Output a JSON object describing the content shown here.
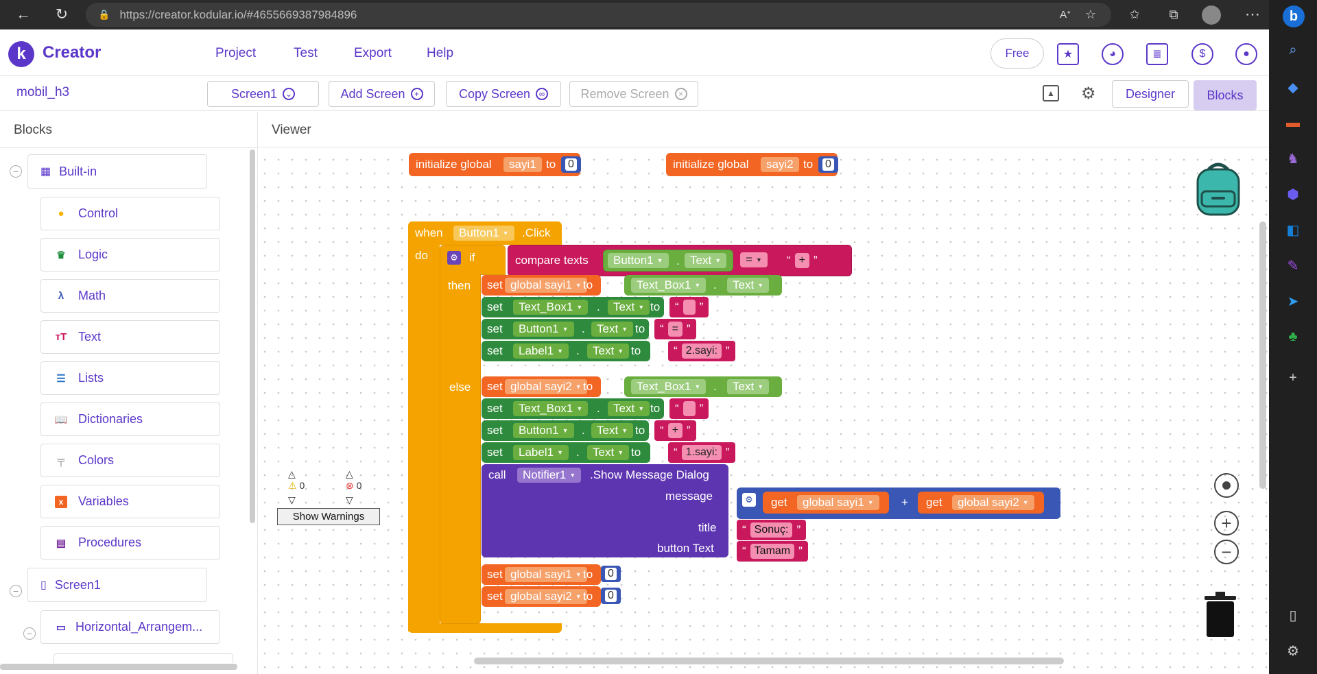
{
  "browser": {
    "url": "https://creator.kodular.io/#4655669387984896"
  },
  "header": {
    "brand": "Creator",
    "logo_letter": "k",
    "menu": [
      "Project",
      "Test",
      "Export",
      "Help"
    ],
    "plan": "Free"
  },
  "toolbar": {
    "project_name": "mobil_h3",
    "screen": "Screen1",
    "add_screen": "Add Screen",
    "copy_screen": "Copy Screen",
    "remove_screen": "Remove Screen",
    "designer": "Designer",
    "blocks": "Blocks"
  },
  "blocks_panel": {
    "title": "Blocks",
    "builtin": "Built-in",
    "categories": [
      {
        "label": "Control",
        "color": "#f4b400"
      },
      {
        "label": "Logic",
        "color": "#1e8e3e"
      },
      {
        "label": "Math",
        "color": "#3a57b5"
      },
      {
        "label": "Text",
        "color": "#c9185b"
      },
      {
        "label": "Lists",
        "color": "#2574c9"
      },
      {
        "label": "Dictionaries",
        "color": "#3a3aa3"
      },
      {
        "label": "Colors",
        "color": "#888888"
      },
      {
        "label": "Variables",
        "color": "#f26522"
      },
      {
        "label": "Procedures",
        "color": "#7b2fa0"
      }
    ],
    "screen": "Screen1",
    "horizontal": "Horizontal_Arrangem..."
  },
  "viewer": {
    "title": "Viewer",
    "show_warnings": "Show Warnings",
    "warnings_count": "0",
    "errors_count": "0"
  },
  "blocks": {
    "init1": {
      "label": "initialize global",
      "name": "sayi1",
      "to": "to",
      "value": "0"
    },
    "init2": {
      "label": "initialize global",
      "name": "sayi2",
      "to": "to",
      "value": "0"
    },
    "event": {
      "when": "when",
      "component": "Button1",
      "event": ".Click",
      "do": "do"
    },
    "if_label": "if",
    "then_label": "then",
    "else_label": "else",
    "compare": {
      "label": "compare texts",
      "component": "Button1",
      "prop": "Text",
      "op": "=",
      "str": "+"
    },
    "set": "set",
    "to": "to",
    "dot": ".",
    "then_rows": {
      "r1": {
        "var": "global sayi1",
        "comp": "Text_Box1",
        "prop": "Text"
      },
      "r2": {
        "comp": "Text_Box1",
        "prop": "Text",
        "str": ""
      },
      "r3": {
        "comp": "Button1",
        "prop": "Text",
        "str": "="
      },
      "r4": {
        "comp": "Label1",
        "prop": "Text",
        "str": "2.sayi:"
      }
    },
    "else_rows": {
      "r1": {
        "var": "global sayi2",
        "comp": "Text_Box1",
        "prop": "Text"
      },
      "r2": {
        "comp": "Text_Box1",
        "prop": "Text",
        "str": ""
      },
      "r3": {
        "comp": "Button1",
        "prop": "Text",
        "str": "+"
      },
      "r4": {
        "comp": "Label1",
        "prop": "Text",
        "str": "1.sayi:"
      }
    },
    "call": {
      "call": "call",
      "component": "Notifier1",
      "method": ".Show Message Dialog",
      "message": "message",
      "get": "get",
      "var1": "global sayi1",
      "plus": "+",
      "var2": "global sayi2",
      "title_label": "title",
      "title_value": "Sonuç:",
      "button_label": "button Text",
      "button_value": "Tamam"
    },
    "reset1": {
      "var": "global sayi1",
      "value": "0"
    },
    "reset2": {
      "var": "global sayi2",
      "value": "0"
    }
  }
}
